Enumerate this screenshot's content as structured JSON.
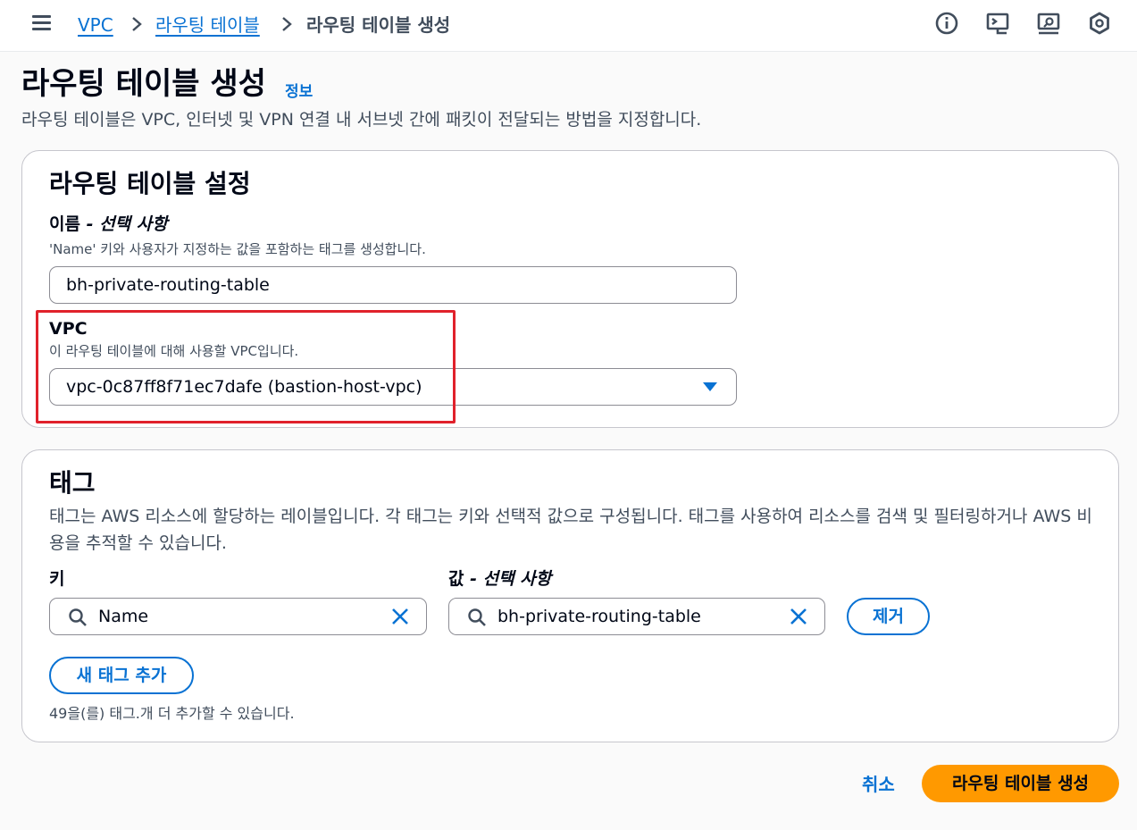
{
  "breadcrumb": {
    "items": [
      "VPC",
      "라우팅 테이블"
    ],
    "current": "라우팅 테이블 생성"
  },
  "header": {
    "icons": [
      "info-icon",
      "cloudshell-icon",
      "console-feedback-icon",
      "settings-hex-icon"
    ]
  },
  "page": {
    "title": "라우팅 테이블 생성",
    "info_link": "정보",
    "description": "라우팅 테이블은 VPC, 인터넷 및 VPN 연결 내 서브넷 간에 패킷이 전달되는 방법을 지정합니다."
  },
  "settings_panel": {
    "title": "라우팅 테이블 설정",
    "name_label": "이름",
    "name_label_suffix": " - 선택 사항",
    "name_hint": "'Name' 키와 사용자가 지정하는 값을 포함하는 태그를 생성합니다.",
    "name_value": "bh-private-routing-table",
    "vpc_label": "VPC",
    "vpc_hint": "이 라우팅 테이블에 대해 사용할 VPC입니다.",
    "vpc_value": "vpc-0c87ff8f71ec7dafe (bastion-host-vpc)"
  },
  "tags_panel": {
    "title": "태그",
    "description": "태그는 AWS 리소스에 할당하는 레이블입니다. 각 태그는 키와 선택적 값으로 구성됩니다. 태그를 사용하여 리소스를 검색 및 필터링하거나 AWS 비용을 추적할 수 있습니다.",
    "key_label": "키",
    "value_label": "값",
    "value_label_suffix": " - 선택 사항",
    "key_value": "Name",
    "value_value": "bh-private-routing-table",
    "remove_button": "제거",
    "add_button": "새 태그 추가",
    "remaining_text": "49을(를) 태그.개 더 추가할 수 있습니다."
  },
  "footer": {
    "cancel": "취소",
    "submit": "라우팅 테이블 생성"
  },
  "colors": {
    "accent": "#0972d3",
    "primary_button": "#ff9900",
    "highlight": "#e0212b"
  }
}
